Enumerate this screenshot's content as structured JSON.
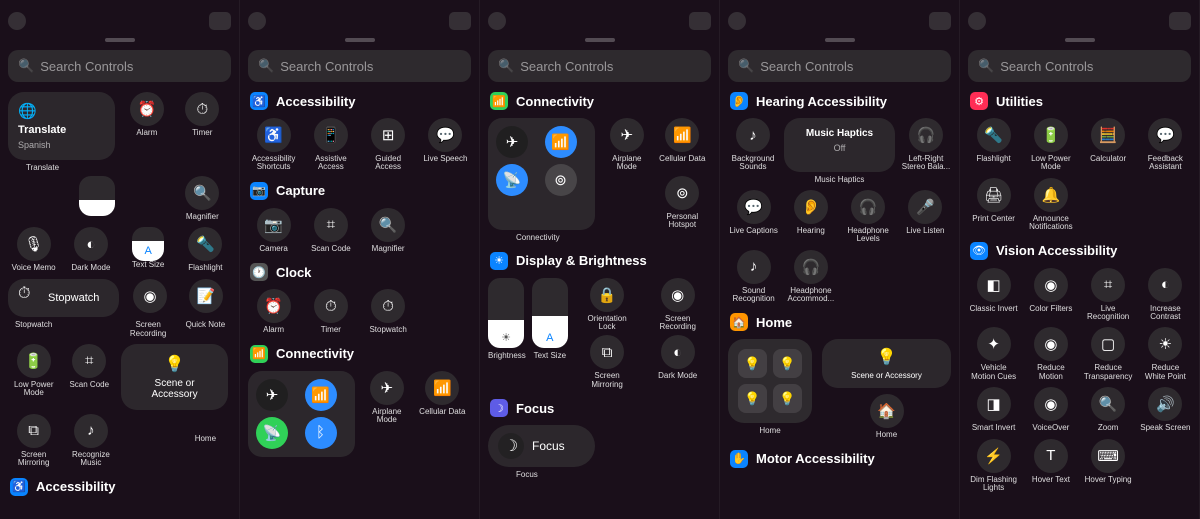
{
  "search_placeholder": "Search Controls",
  "panels": {
    "p1": {
      "translate": {
        "title": "Translate",
        "sub": "Spanish",
        "small": "Translate"
      },
      "row1": [
        "Alarm",
        "Timer"
      ],
      "row2": [
        "Magnifier"
      ],
      "row3": [
        "Voice Memo",
        "Dark Mode",
        "Text Size",
        "Flashlight"
      ],
      "stopwatch": "Stopwatch",
      "row4": [
        "Stopwatch",
        "Screen\nRecording",
        "Quick Note"
      ],
      "row5": [
        "Low Power\nMode",
        "Scan Code"
      ],
      "scene": "Scene or\nAccessory",
      "row6": [
        "Screen\nMirroring",
        "Recognize\nMusic",
        "Home"
      ],
      "sectionA": "Accessibility"
    },
    "p2": {
      "sectionAcc": "Accessibility",
      "acc": [
        "Accessibility\nShortcuts",
        "Assistive\nAccess",
        "Guided\nAccess",
        "Live Speech"
      ],
      "sectionCap": "Capture",
      "cap": [
        "Camera",
        "Scan Code",
        "Magnifier"
      ],
      "sectionClock": "Clock",
      "clock": [
        "Alarm",
        "Timer",
        "Stopwatch"
      ],
      "sectionConn": "Connectivity",
      "conn": [
        "Airplane\nMode",
        "Cellular Data"
      ]
    },
    "p3": {
      "sectionConn": "Connectivity",
      "conn_labels": [
        "Airplane\nMode",
        "Cellular Data",
        "Connectivity",
        "Personal\nHotspot"
      ],
      "sectionDisp": "Display & Brightness",
      "disp": [
        "Brightness",
        "Text Size",
        "Orientation\nLock",
        "Screen\nRecording",
        "Screen\nMirroring",
        "Dark Mode"
      ],
      "sectionFocus": "Focus",
      "focus": "Focus"
    },
    "p4": {
      "sectionHear": "Hearing Accessibility",
      "music_haptics": {
        "title": "Music\nHaptics",
        "state": "Off"
      },
      "hear1": [
        "Background\nSounds",
        "Music Haptics",
        "Left-Right\nStereo Bala..."
      ],
      "hear2": [
        "Live Captions",
        "Hearing",
        "Headphone\nLevels",
        "Live Listen"
      ],
      "hear3": [
        "Sound\nRecognition",
        "Headphone\nAccommod..."
      ],
      "sectionHome": "Home",
      "home_lbls": [
        "Home",
        "Scene or Accessory",
        "Home"
      ],
      "sectionMotor": "Motor Accessibility"
    },
    "p5": {
      "sectionUtil": "Utilities",
      "util1": [
        "Flashlight",
        "Low Power\nMode",
        "Calculator",
        "Feedback\nAssistant"
      ],
      "util2": [
        "Print Center",
        "Announce\nNotifications"
      ],
      "sectionVision": "Vision Accessibility",
      "v1": [
        "Classic Invert",
        "Color Filters",
        "Live\nRecognition",
        "Increase\nContrast"
      ],
      "v2": [
        "Vehicle\nMotion Cues",
        "Reduce\nMotion",
        "Reduce\nTransparency",
        "Reduce\nWhite Point"
      ],
      "v3": [
        "Smart Invert",
        "VoiceOver",
        "Zoom",
        "Speak Screen"
      ],
      "v4": [
        "Dim Flashing\nLights",
        "Hover Text",
        "Hover Typing"
      ]
    }
  },
  "icons": {
    "alarm": "⏰",
    "timer": "⏱",
    "magnifier": "🔍",
    "voice": "🎙",
    "dark": "◐",
    "text": "A",
    "flash": "🔦",
    "stopwatch": "⏱",
    "record": "◉",
    "note": "📝",
    "lowpower": "🔋",
    "scan": "⌗",
    "home": "💡",
    "mirror": "⧉",
    "music": "♪",
    "access": "♿",
    "assistive": "📱",
    "guided": "⊞",
    "speech": "💬",
    "camera": "📷",
    "clock": "🕐",
    "plane": "✈",
    "cell": "📶",
    "wifi": "📡",
    "bt": "ᛒ",
    "hotspot": "⊚",
    "bright": "☀",
    "lock": "🔒",
    "focus": "☽",
    "ear": "👂",
    "headphone": "🎧",
    "mic": "🎤",
    "calc": "🧮",
    "feedback": "💬",
    "print": "🖨",
    "announce": "🔔",
    "invert": "◧",
    "filter": "◉",
    "eye": "👁",
    "contrast": "◐",
    "motion": "⚙",
    "zoom": "🔍",
    "speak": "🔊",
    "keyboard": "⌨",
    "battery": "🔋"
  }
}
